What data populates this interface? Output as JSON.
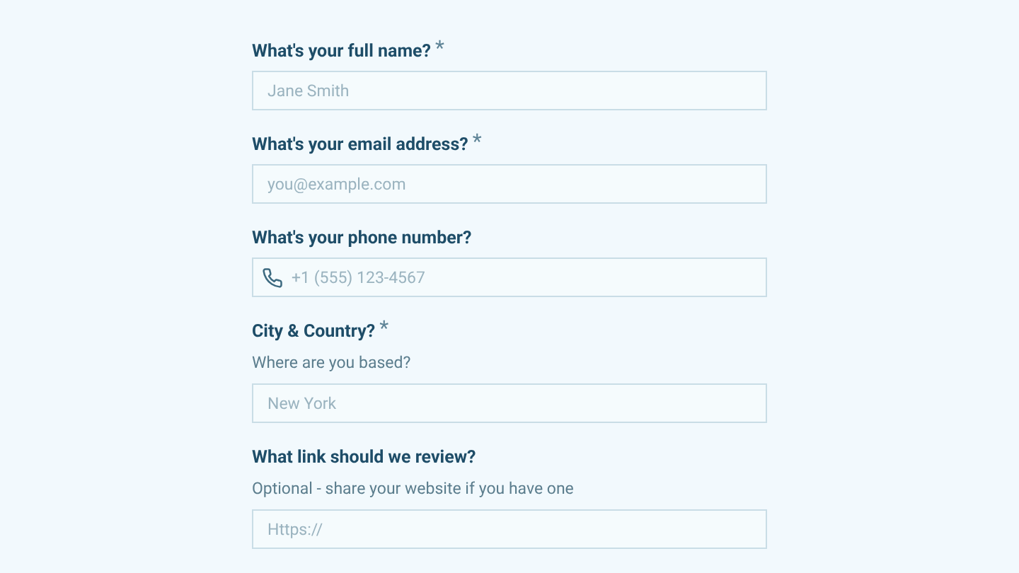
{
  "fields": [
    {
      "label": "What's your full name?",
      "required_mark": "*",
      "kind": "text",
      "placeholder": "Jane Smith"
    },
    {
      "label": "What's your email address?",
      "required_mark": "*",
      "kind": "text",
      "placeholder": "you@example.com"
    },
    {
      "label": "What's your phone number?",
      "kind": "phone",
      "placeholder": "+1 (555) 123-4567"
    },
    {
      "label": "City & Country?",
      "required_mark": "*",
      "hint": "Where are you based?",
      "kind": "text",
      "placeholder": "New York"
    },
    {
      "label": "What link should we review?",
      "hint": "Optional - share your website if you have one",
      "kind": "text",
      "placeholder": "Https://"
    }
  ]
}
